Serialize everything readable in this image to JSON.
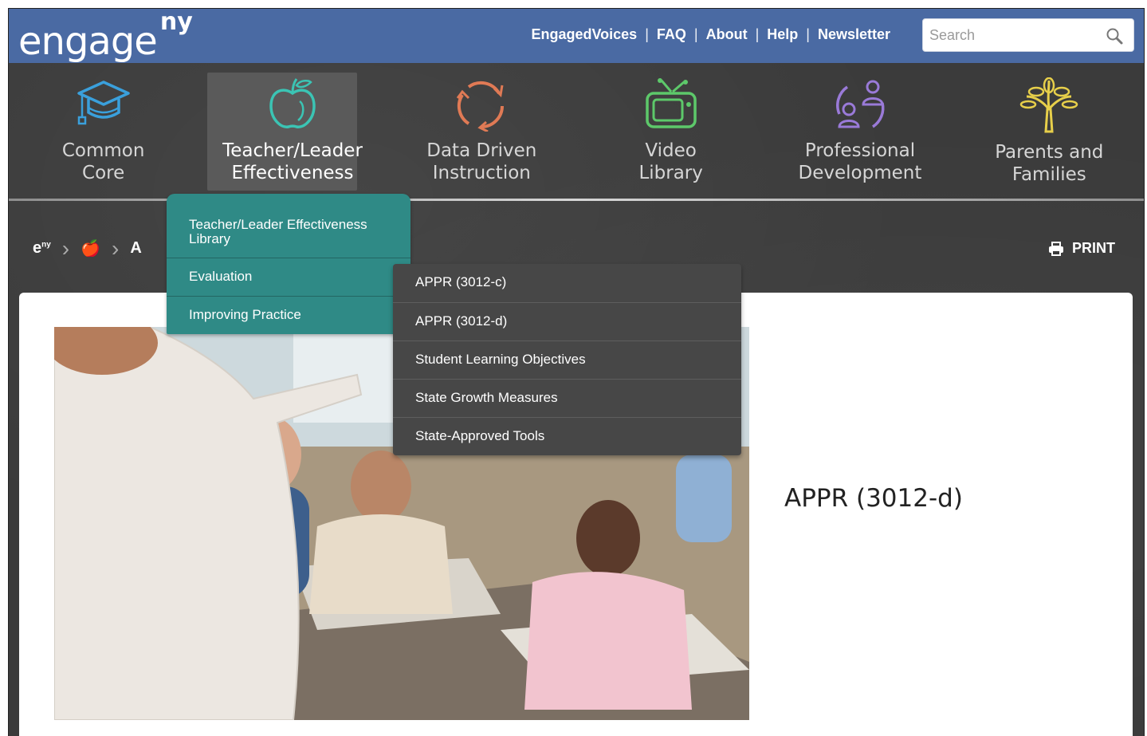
{
  "header": {
    "logo_text": "engage",
    "logo_sup": "ny",
    "links": [
      "EngagedVoices",
      "FAQ",
      "About",
      "Help",
      "Newsletter"
    ],
    "search_placeholder": "Search",
    "accent": "#4a6aa3"
  },
  "mainnav": {
    "items": [
      {
        "label": "Common\nCore",
        "icon": "graduation-cap-icon",
        "color": "#3aa0dc"
      },
      {
        "label": "Teacher/Leader\nEffectiveness",
        "icon": "apple-icon",
        "color": "#3bc4b4"
      },
      {
        "label": "Data Driven\nInstruction",
        "icon": "cycle-arrows-icon",
        "color": "#e07a55"
      },
      {
        "label": "Video\nLibrary",
        "icon": "tv-icon",
        "color": "#5dc86a"
      },
      {
        "label": "Professional\nDevelopment",
        "icon": "people-exchange-icon",
        "color": "#9a7ad8"
      },
      {
        "label": "Parents and\nFamilies",
        "icon": "tree-icon",
        "color": "#e7cf4a"
      }
    ]
  },
  "breadcrumb": {
    "home": "e",
    "home_sup": "ny",
    "apple": "🍎",
    "current_initial": "A"
  },
  "print_label": "PRINT",
  "dropdown": {
    "items": [
      {
        "label": "Teacher/Leader Effectiveness Library"
      },
      {
        "label": "Evaluation"
      },
      {
        "label": "Improving Practice"
      }
    ],
    "color": "#2f8a86"
  },
  "submenu": {
    "items": [
      "APPR (3012-c)",
      "APPR (3012-d)",
      "Student Learning Objectives",
      "State Growth Measures",
      "State-Approved Tools"
    ]
  },
  "card": {
    "title": "APPR (3012-d)"
  }
}
